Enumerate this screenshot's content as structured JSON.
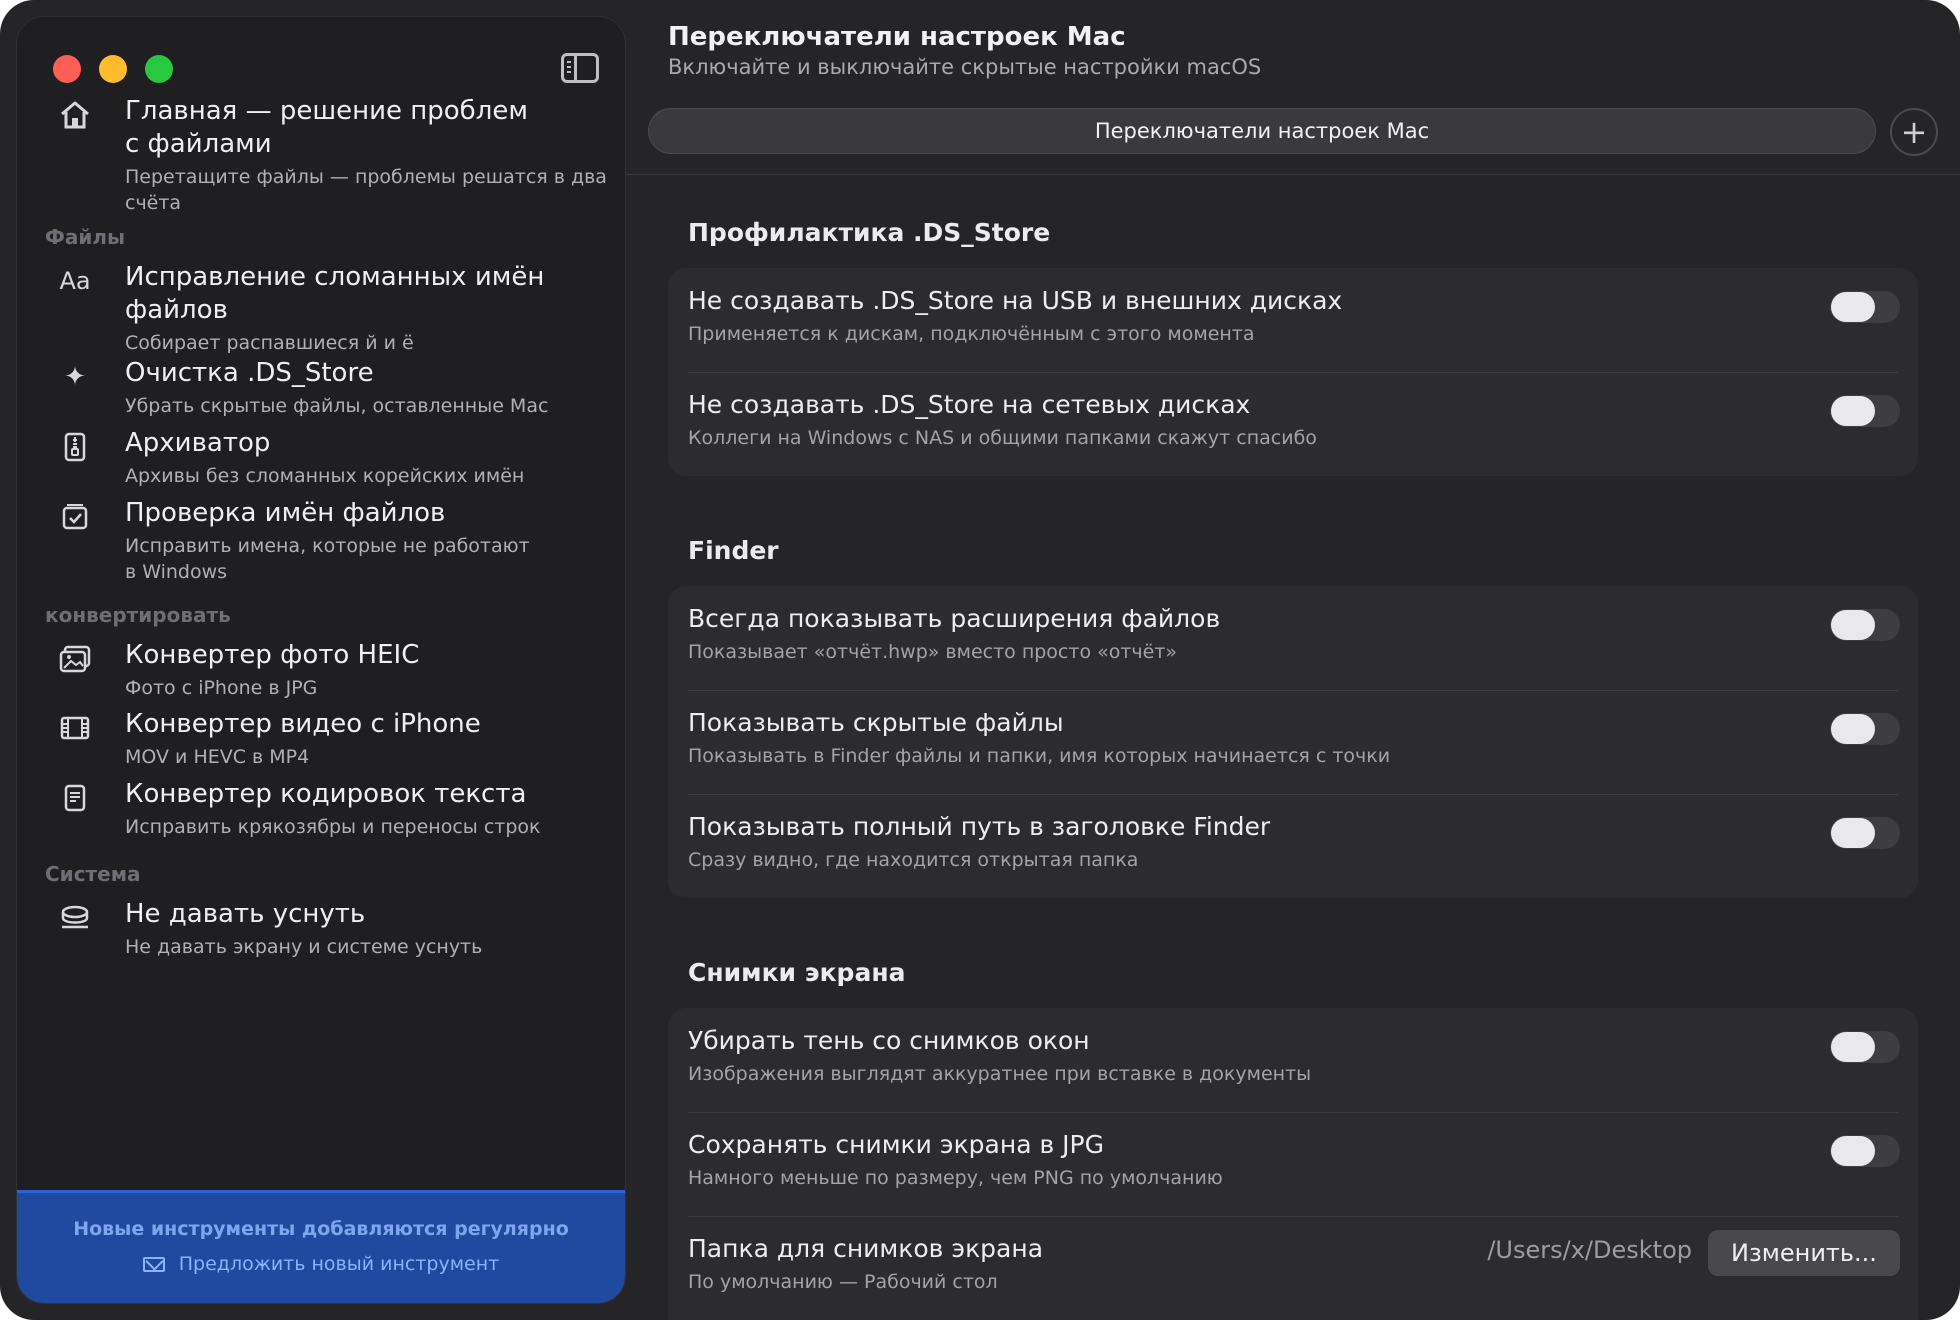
{
  "sidebar": {
    "home": {
      "title_line1": "Главная — решение проблем",
      "title_line2": "с файлами",
      "subtitle_line1": "Перетащите файлы — проблемы решатся в два",
      "subtitle_line2": "счёта",
      "icon": "house-icon"
    },
    "sections": [
      {
        "label": "Файлы"
      },
      {
        "label": "конвертировать"
      },
      {
        "label": "Система"
      }
    ],
    "items": [
      {
        "icon": "Aa",
        "title_line1": "Исправление сломанных имён",
        "title_line2": "файлов",
        "subtitle": "Собирает распавшиеся й и ё"
      },
      {
        "icon": "✦",
        "title": "Очистка .DS_Store",
        "subtitle": "Убрать скрытые файлы, оставленные Mac"
      },
      {
        "icon": "archive-icon",
        "title": "Архиватор",
        "subtitle": "Архивы без сломанных корейских имён"
      },
      {
        "icon": "checklist-icon",
        "title": "Проверка имён файлов",
        "subtitle_line1": "Исправить имена, которые не работают",
        "subtitle_line2": "в Windows"
      },
      {
        "icon": "photo-icon",
        "title": "Конвертер фото HEIC",
        "subtitle": "Фото с iPhone в JPG"
      },
      {
        "icon": "film-icon",
        "title": "Конвертер видео с iPhone",
        "subtitle": "MOV и HEVC в MP4"
      },
      {
        "icon": "document-icon",
        "title": "Конвертер кодировок текста",
        "subtitle": "Исправить крякозябры и переносы строк"
      },
      {
        "icon": "cup-icon",
        "title": "Не давать уснуть",
        "subtitle": "Не давать экрану и системе уснуть"
      }
    ],
    "footer": {
      "note": "Новые инструменты добавляются регулярно",
      "link": "Предложить новый инструмент"
    }
  },
  "header": {
    "title": "Переключатели настроек Mac",
    "subtitle": "Включайте и выключайте скрытые настройки macOS",
    "tab": "Переключатели настроек Mac",
    "add_label": "+"
  },
  "groups": [
    {
      "title": "Профилактика .DS_Store",
      "rows": [
        {
          "title": "Не создавать .DS_Store на USB и внешних дисках",
          "subtitle": "Применяется к дискам, подключённым с этого момента",
          "on": false
        },
        {
          "title": "Не создавать .DS_Store на сетевых дисках",
          "subtitle": "Коллеги на Windows с NAS и общими папками скажут спасибо",
          "on": false
        }
      ]
    },
    {
      "title": "Finder",
      "rows": [
        {
          "title": "Всегда показывать расширения файлов",
          "subtitle": "Показывает «отчёт.hwp» вместо просто «отчёт»",
          "on": false
        },
        {
          "title": "Показывать скрытые файлы",
          "subtitle": "Показывать в Finder файлы и папки, имя которых начинается с точки",
          "on": false
        },
        {
          "title": "Показывать полный путь в заголовке Finder",
          "subtitle": "Сразу видно, где находится открытая папка",
          "on": false
        }
      ]
    },
    {
      "title": "Снимки экрана",
      "rows": [
        {
          "title": "Убирать тень со снимков окон",
          "subtitle": "Изображения выглядят аккуратнее при вставке в документы",
          "on": false
        },
        {
          "title": "Сохранять снимки экрана в JPG",
          "subtitle": "Намного меньше по размеру, чем PNG по умолчанию",
          "on": false
        },
        {
          "title": "Папка для снимков экрана",
          "subtitle": "По умолчанию — Рабочий стол",
          "value": "/Users/x/Desktop",
          "button": "Изменить..."
        }
      ]
    }
  ],
  "colors": {
    "accent": "#1f4aa0",
    "background": "#252528",
    "sidebar": "#1f1f22"
  }
}
